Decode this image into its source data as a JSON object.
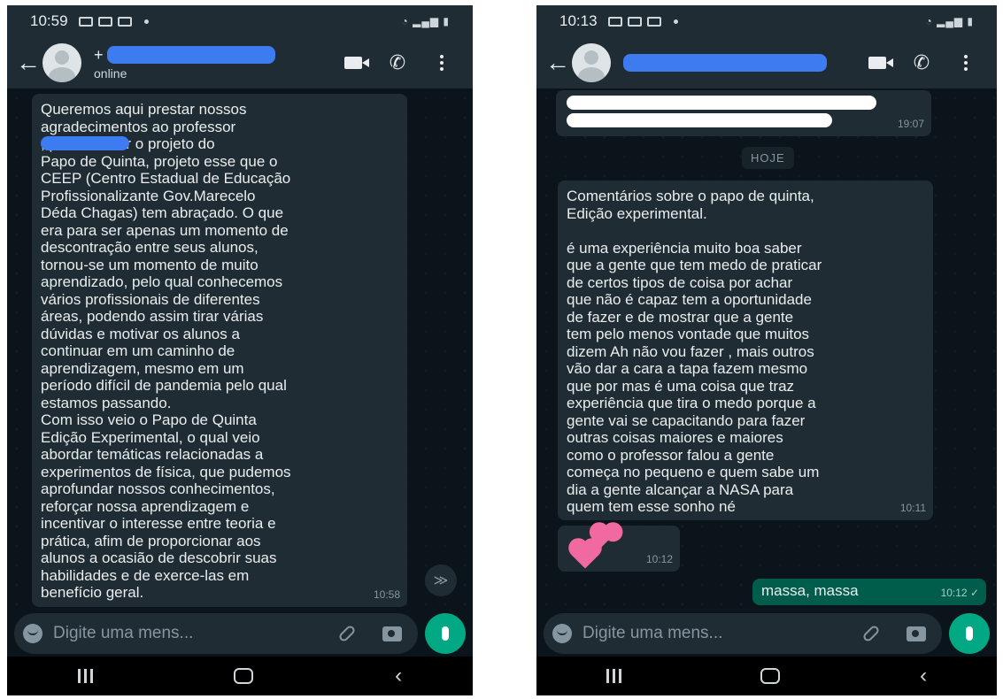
{
  "left": {
    "status_time": "10:59",
    "contact_status": "online",
    "message": "Queremos aqui prestar nossos\nagradecimentos ao professor\n                , por idealizar o projeto do\nPapo de Quinta, projeto esse que o\nCEEP (Centro Estadual de Educação\nProfissionalizante Gov.Marecelo\nDéda Chagas) tem abraçado. O que\nera para ser apenas um momento de\ndescontração entre seus alunos,\ntornou-se um momento de muito\naprendizado, pelo qual conhecemos\nvários profissionais de diferentes\náreas, podendo assim tirar várias\ndúvidas e motivar os alunos a\ncontinuar em um caminho de\naprendizagem, mesmo em um\nperíodo difícil de pandemia pelo qual\nestamos passando.\nCom isso veio o Papo de Quinta\nEdição Experimental, o qual veio\nabordar temáticas relacionadas a\nexperimentos de física, que pudemos\naprofundar nossos conhecimentos,\nreforçar nossa aprendizagem e\nincentivar o interesse entre teoria e\nprática, afim de proporcionar aos\nalunos a ocasião de descobrir suas\nhabilidades e de exerce-las em\nbenefício geral.",
    "message_time": "10:58",
    "input_placeholder": "Digite uma mens...",
    "scroll_glyph": "≫"
  },
  "right": {
    "status_time": "10:13",
    "first_time": "19:07",
    "date_chip": "HOJE",
    "message": "Comentários sobre o papo de quinta,\nEdição  experimental.\n\né uma experiência muito boa saber\nque a gente que tem medo de praticar\nde certos tipos de coisa por achar\nque não é capaz tem a oportunidade\nde fazer e de mostrar que a gente\ntem pelo menos vontade que muitos\ndizem Ah não vou fazer , mais outros\nvão dar a cara a tapa fazem mesmo\nque por mas é uma coisa que traz\nexperiência que tira o medo porque a\ngente vai se capacitando para fazer\noutras coisas maiores e maiores\ncomo o professor falou a gente\ncomeça no pequeno e quem sabe um\ndia a gente alcançar a NASA para\nquem tem esse sonho né",
    "message_time": "10:11",
    "heart_time": "10:12",
    "reply_text": "massa, massa",
    "reply_time": "10:12 ✓",
    "input_placeholder": "Digite uma mens..."
  },
  "colors": {
    "header": "#1f2c34",
    "chat_bg": "#0b141a",
    "incoming_bubble": "#202c33",
    "outgoing_bubble": "#005c4b",
    "accent": "#00a884",
    "redaction": "#3d7cf0"
  }
}
